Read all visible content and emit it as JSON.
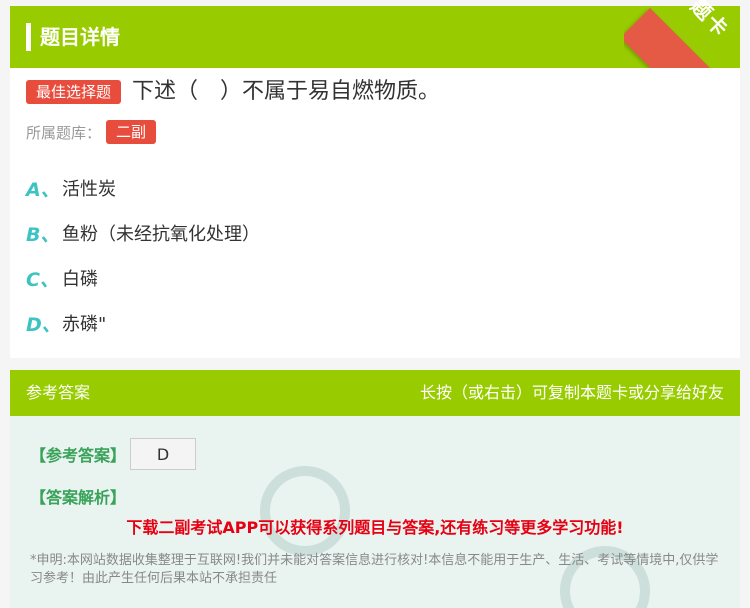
{
  "header": {
    "title": "题目详情",
    "corner_label": "题卡"
  },
  "question": {
    "type_badge": "最佳选择题",
    "stem": "下述（　）不属于易自燃物质。",
    "bank_label": "所属题库：",
    "bank_tag": "二副",
    "options": [
      {
        "letter": "A、",
        "text": "活性炭"
      },
      {
        "letter": "B、",
        "text": "鱼粉（未经抗氧化处理）"
      },
      {
        "letter": "C、",
        "text": "白磷"
      },
      {
        "letter": "D、",
        "text": "赤磷\""
      }
    ]
  },
  "answer": {
    "bar_title": "参考答案",
    "bar_tip": "长按（或右击）可复制本题卡或分享给好友",
    "ref_label": "【参考答案】",
    "ref_value": "D",
    "analysis_label": "【答案解析】",
    "promo": "下载二副考试APP可以获得系列题目与答案,还有练习等更多学习功能!",
    "disclaimer": "*申明:本网站数据收集整理于互联网!我们并未能对答案信息进行核对!本信息不能用于生产、生活、考试等情境中,仅供学习参考！由此产生任何后果本站不承担责任"
  },
  "colors": {
    "green": "#99cc00",
    "red": "#e84c3d",
    "teal": "#3ec3c3"
  }
}
